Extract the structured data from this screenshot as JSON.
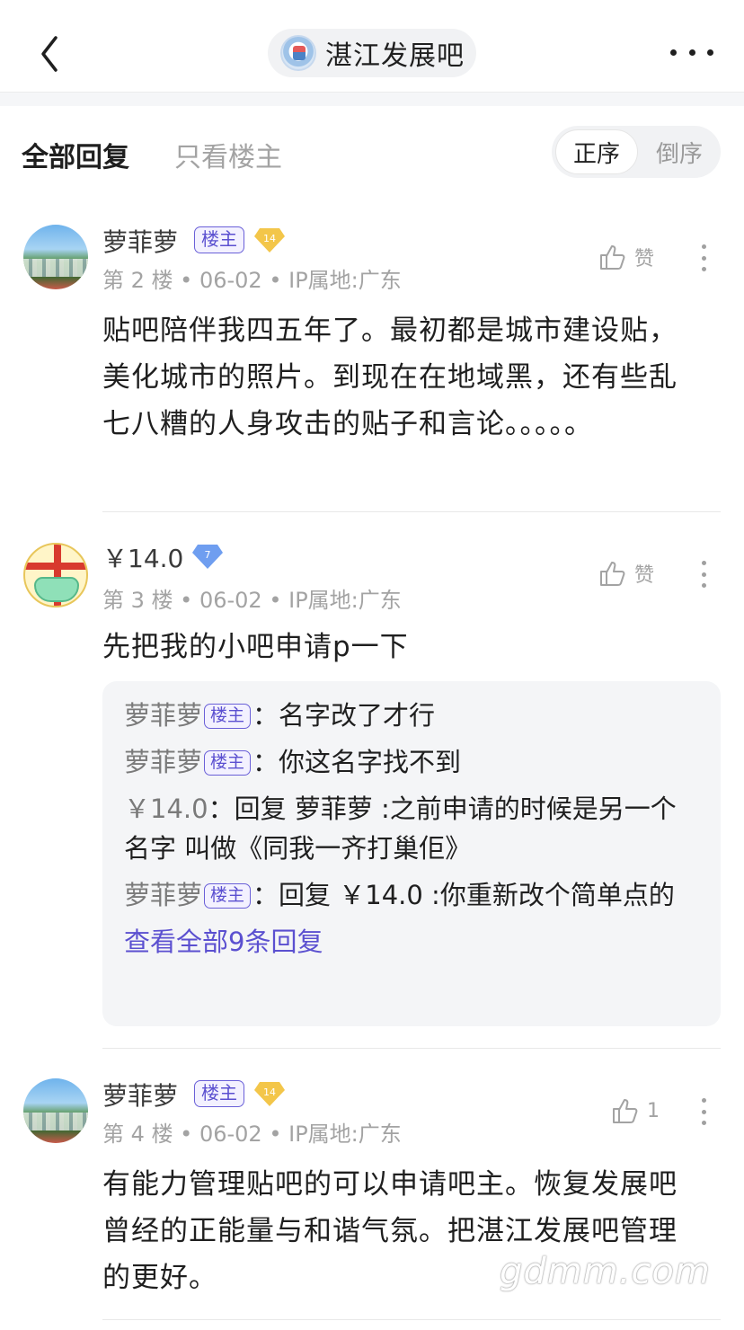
{
  "header": {
    "forum_name": "湛江发展吧"
  },
  "filters": {
    "all_replies": "全部回复",
    "owner_only": "只看楼主",
    "sort_asc": "正序",
    "sort_desc": "倒序"
  },
  "posts": [
    {
      "username": "萝菲萝",
      "owner_badge": "楼主",
      "level": "14",
      "floor": "第 2 楼",
      "date": "06-02",
      "ip": "IP属地:广东",
      "like_label": "赞",
      "content": "贴吧陪伴我四五年了。最初都是城市建设贴，美化城市的照片。到现在在地域黑，还有些乱七八糟的人身攻击的贴子和言论。。。。。"
    },
    {
      "username": "￥14.0",
      "level": "7",
      "floor": "第 3 楼",
      "date": "06-02",
      "ip": "IP属地:广东",
      "like_label": "赞",
      "content": "先把我的小吧申请p一下",
      "replies": [
        {
          "name": "萝菲萝",
          "badge": "楼主",
          "text": "名字改了才行"
        },
        {
          "name": "萝菲萝",
          "badge": "楼主",
          "text": "你这名字找不到"
        },
        {
          "name": "￥14.0",
          "badge": "",
          "text": "回复 萝菲萝 :之前申请的时候是另一个名字 叫做《同我一齐打巢佢》"
        },
        {
          "name": "萝菲萝",
          "badge": "楼主",
          "text": "回复 ￥14.0 :你重新改个简单点的"
        }
      ],
      "view_all": "查看全部9条回复"
    },
    {
      "username": "萝菲萝",
      "owner_badge": "楼主",
      "level": "14",
      "floor": "第 4 楼",
      "date": "06-02",
      "ip": "IP属地:广东",
      "like_count": "1",
      "content": "有能力管理贴吧的可以申请吧主。恢复发展吧曾经的正能量与和谐气氛。把湛江发展吧管理的更好。"
    }
  ],
  "watermark": "gdmm.com",
  "colors": {
    "accent": "#5b50d0",
    "secondary_text": "#a3a3a3",
    "level_badge_gold": "#f3c64a",
    "level_badge_blue": "#6f9ef0"
  }
}
